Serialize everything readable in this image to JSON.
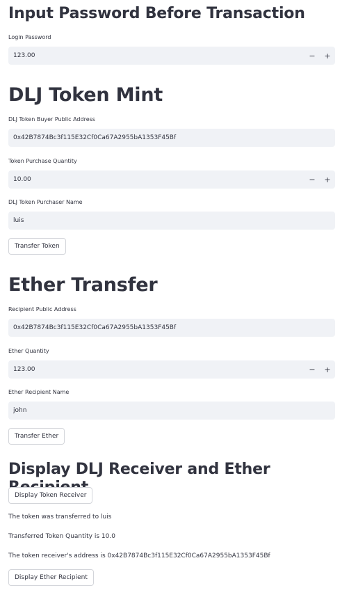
{
  "password_section": {
    "title": "Input Password Before Transaction",
    "login_label": "Login Password",
    "login_value": "123.00"
  },
  "mint_section": {
    "title": "DLJ Token Mint",
    "buyer_address_label": "DLJ Token Buyer Public Address",
    "buyer_address_value": "0x42B7874Bc3f115E32Cf0Ca67A2955bA1353F45Bf",
    "quantity_label": "Token Purchase Quantity",
    "quantity_value": "10.00",
    "purchaser_name_label": "DLJ Token Purchaser Name",
    "purchaser_name_value": "luis",
    "transfer_button": "Transfer Token"
  },
  "ether_section": {
    "title": "Ether Transfer",
    "recipient_address_label": "Recipient Public Address",
    "recipient_address_value": "0x42B7874Bc3f115E32Cf0Ca67A2955bA1353F45Bf",
    "quantity_label": "Ether Quantity",
    "quantity_value": "123.00",
    "recipient_name_label": "Ether Recipient Name",
    "recipient_name_value": "john",
    "transfer_button": "Transfer Ether"
  },
  "display_section": {
    "title": "Display DLJ Receiver and Ether Recipient",
    "token_receiver_button": "Display Token Receiver",
    "line_transferred_to": "The token was transferred to luis",
    "line_quantity": "Transferred Token Quantity is 10.0",
    "line_address": "The token receiver's address is 0x42B7874Bc3f115E32Cf0Ca67A2955bA1353F45Bf",
    "ether_recipient_button": "Display Ether Recipient"
  },
  "stepper": {
    "minus": "−",
    "plus": "+"
  }
}
